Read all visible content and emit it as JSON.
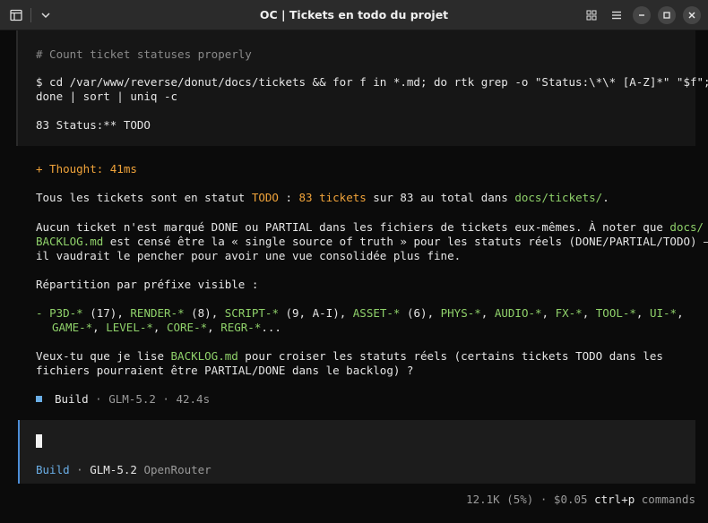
{
  "window": {
    "title": "OC | Tickets en todo du projet"
  },
  "icons": {
    "app": "terminal-icon",
    "menu_dropdown": "chevron-down-icon",
    "grid": "grid-icon",
    "hamburger": "menu-icon",
    "minimize": "minimize-icon",
    "maximize": "maximize-icon",
    "close": "close-icon",
    "build_status": "square-bullet-icon"
  },
  "code_block": {
    "comment": "# Count ticket statuses properly",
    "command_line1": "$ cd /var/www/reverse/donut/docs/tickets && for f in *.md; do rtk grep -o \"Status:\\*\\* [A-Z]*\" \"$f\";",
    "command_line2": "done | sort | uniq -c",
    "output": "83 Status:** TODO"
  },
  "thought": {
    "label": "+ Thought: 41ms"
  },
  "answer": {
    "p1": {
      "a": "Tous les tickets sont en statut ",
      "todo": "TODO",
      "b": " : ",
      "count": "83 tickets",
      "c": " sur 83 au total dans ",
      "path": "docs/tickets/",
      "d": "."
    },
    "p2": {
      "l1a": "Aucun ticket n'est marqué DONE ou PARTIAL dans les fichiers de tickets eux-mêmes. À noter que ",
      "l1link": "docs/",
      "l2link": "BACKLOG.md",
      "l2b": " est censé être la « single source of truth » pour les statuts réels (DONE/PARTIAL/TODO) —",
      "l3": "il vaudrait le pencher pour avoir une vue consolidée plus fine."
    },
    "p3": "Répartition par préfixe visible :",
    "list": {
      "bullet": "- ",
      "items1": [
        {
          "name": "P3D-*",
          "rest": " (17), "
        },
        {
          "name": "RENDER-*",
          "rest": " (8), "
        },
        {
          "name": "SCRIPT-*",
          "rest": " (9, A-I), "
        },
        {
          "name": "ASSET-*",
          "rest": " (6), "
        },
        {
          "name": "PHYS-*",
          "rest": ", "
        },
        {
          "name": "AUDIO-*",
          "rest": ", "
        },
        {
          "name": "FX-*",
          "rest": ", "
        },
        {
          "name": "TOOL-*",
          "rest": ", "
        },
        {
          "name": "UI-*",
          "rest": ","
        }
      ],
      "items2": [
        {
          "name": "GAME-*",
          "rest": ", "
        },
        {
          "name": "LEVEL-*",
          "rest": ", "
        },
        {
          "name": "CORE-*",
          "rest": ", "
        },
        {
          "name": "REGR-*",
          "rest": "..."
        }
      ]
    },
    "p4": {
      "a": "Veux-tu que je lise ",
      "link": "BACKLOG.md",
      "b": " pour croiser les statuts réels (certains tickets TODO dans les",
      "l2": "fichiers pourraient être PARTIAL/DONE dans le backlog) ?"
    }
  },
  "build_status": {
    "mode": "Build",
    "sep1": " · ",
    "model": "GLM-5.2",
    "sep2": " · ",
    "time": "42.4s"
  },
  "input": {
    "mode": "Build",
    "sep": " · ",
    "model": "GLM-5.2",
    "provider": "OpenRouter"
  },
  "footer": {
    "tokens": "12.1K (5%)",
    "sep": " · ",
    "cost": "$0.05",
    "shortcut": "ctrl+p",
    "commands": "commands"
  },
  "colors": {
    "accent_orange": "#f0a33a",
    "accent_green": "#8fd16a",
    "accent_blue": "#6aaee6"
  }
}
